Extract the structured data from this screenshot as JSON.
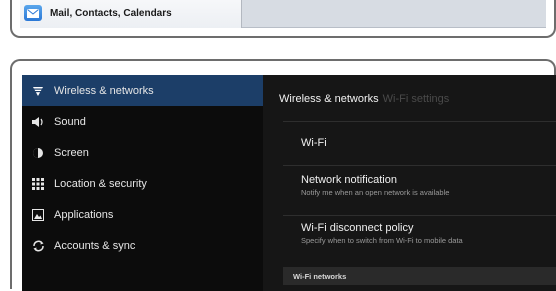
{
  "ios": {
    "cell_label": "Mail, Contacts, Calendars"
  },
  "android": {
    "menu": [
      {
        "label": "Wireless & networks",
        "icon": "wifi-icon",
        "active": true
      },
      {
        "label": "Sound",
        "icon": "speaker-icon",
        "active": false
      },
      {
        "label": "Screen",
        "icon": "screen-brightness-icon",
        "active": false
      },
      {
        "label": "Location & security",
        "icon": "location-grid-icon",
        "active": false
      },
      {
        "label": "Applications",
        "icon": "applications-icon",
        "active": false
      },
      {
        "label": "Accounts & sync",
        "icon": "sync-icon",
        "active": false
      }
    ],
    "breadcrumb": {
      "current": "Wireless & networks",
      "next": "Wi-Fi settings"
    },
    "prefs": [
      {
        "title": "Wi-Fi",
        "summary": ""
      },
      {
        "title": "Network notification",
        "summary": "Notify me when an open network is available"
      },
      {
        "title": "Wi-Fi disconnect policy",
        "summary": "Specify when to switch from Wi-Fi to mobile data"
      }
    ],
    "section_header": "Wi-Fi networks",
    "colors": {
      "active_highlight": "#1c3e68",
      "background": "#000000"
    }
  }
}
